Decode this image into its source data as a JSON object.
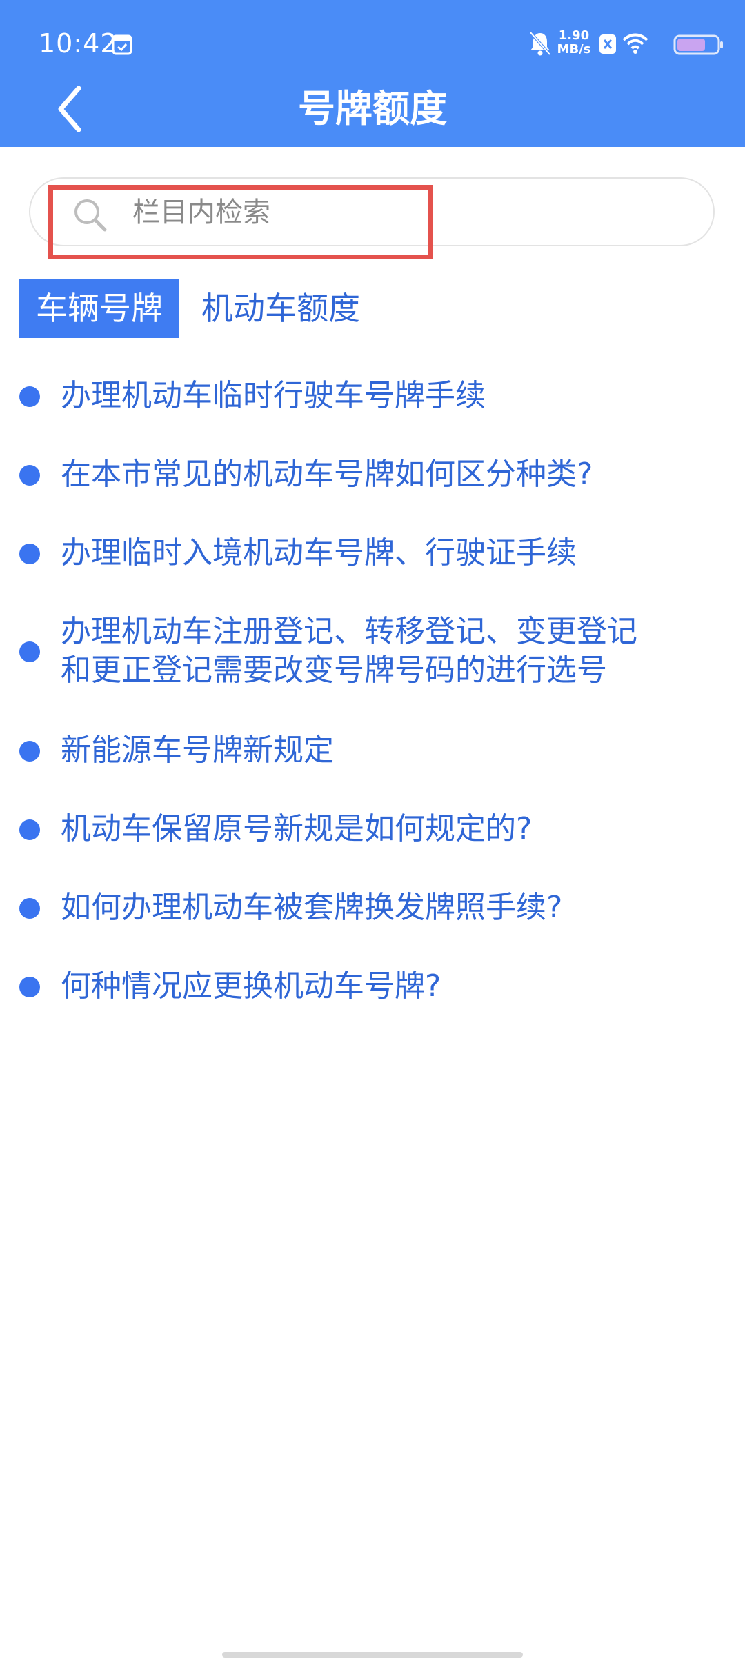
{
  "status_bar": {
    "time": "10:42",
    "net_speed_value": "1.90",
    "net_speed_unit": "MB/s",
    "icons": [
      "calendar-icon",
      "bell-muted-icon",
      "x-badge-icon",
      "wifi-icon",
      "battery-icon"
    ]
  },
  "header": {
    "title": "号牌额度",
    "back_icon": "chevron-left-icon",
    "background_color": "#4a8cf7"
  },
  "search": {
    "placeholder": "栏目内检索",
    "value": "",
    "icon": "search-icon",
    "highlight_color": "#e4524d"
  },
  "tabs": [
    {
      "label": "车辆号牌",
      "active": true
    },
    {
      "label": "机动车额度",
      "active": false
    }
  ],
  "list": {
    "items": [
      {
        "label": "办理机动车临时行驶车号牌手续"
      },
      {
        "label": "在本市常见的机动车号牌如何区分种类?"
      },
      {
        "label": "办理临时入境机动车号牌、行驶证手续"
      },
      {
        "label_line1": "办理机动车注册登记、转移登记、变更登记",
        "label_line2": "和更正登记需要改变号牌号码的进行选号"
      },
      {
        "label": "新能源车号牌新规定"
      },
      {
        "label": "机动车保留原号新规是如何规定的?"
      },
      {
        "label": "如何办理机动车被套牌换发牌照手续?"
      },
      {
        "label": "何种情况应更换机动车号牌?"
      }
    ],
    "accent_color": "#2f66d6"
  }
}
